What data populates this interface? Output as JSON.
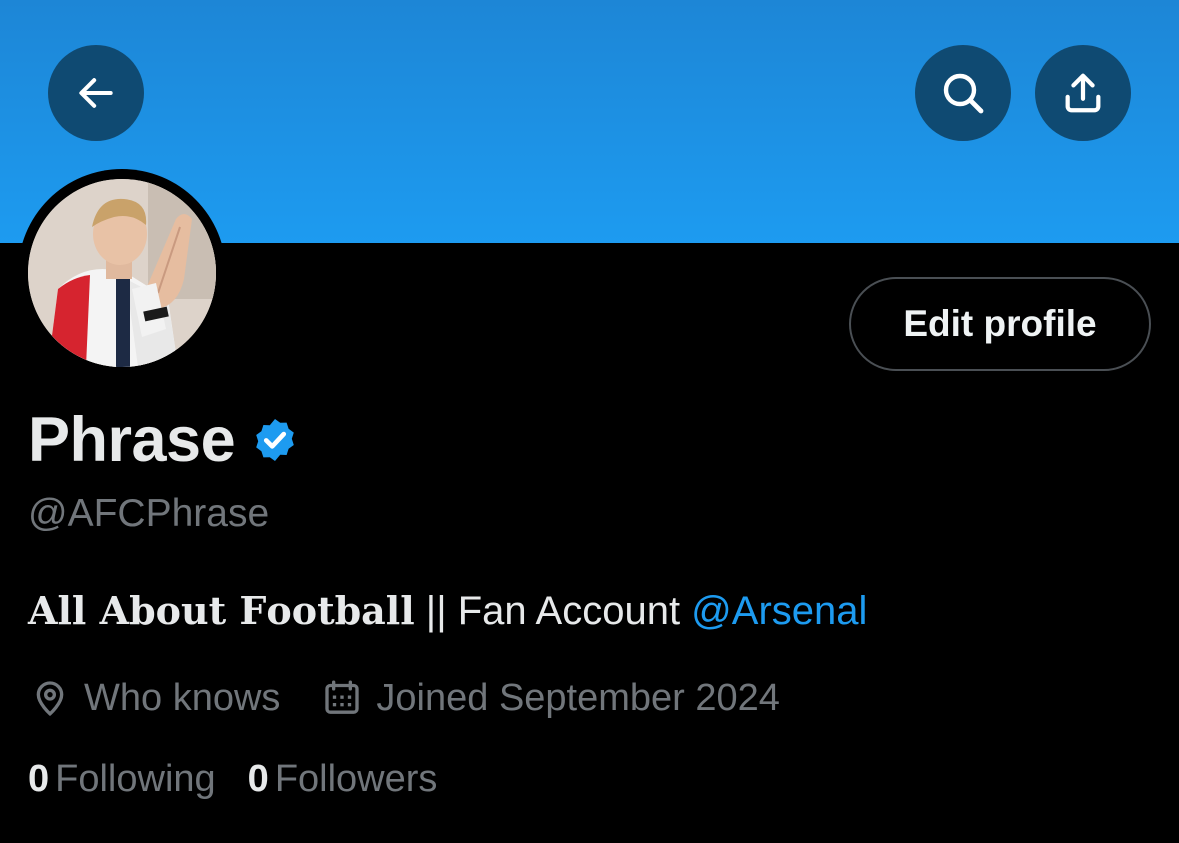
{
  "header": {
    "back_icon": "arrow-left-icon",
    "search_icon": "search-icon",
    "share_icon": "share-upload-icon",
    "banner_color": "#1d9bf0",
    "button_color": "#0f4a72"
  },
  "profile": {
    "edit_label": "Edit profile",
    "display_name": "Phrase",
    "verified_icon": "verified-badge-icon",
    "verified_color": "#1d9bf0",
    "handle": "@AFCPhrase",
    "bio": {
      "styled_part": "𝐀𝐥𝐥 𝐀𝐛𝐨𝐮𝐭 𝐅𝐨𝐨𝐭𝐛𝐚𝐥𝐥",
      "plain_part": " || Fan Account ",
      "mention": "@Arsenal",
      "mention_color": "#1d9bf0"
    },
    "location_icon": "location-pin-icon",
    "location": "Who knows",
    "joined_icon": "calendar-icon",
    "joined": "Joined September 2024",
    "following_count": "0",
    "following_label": "Following",
    "followers_count": "0",
    "followers_label": "Followers"
  }
}
